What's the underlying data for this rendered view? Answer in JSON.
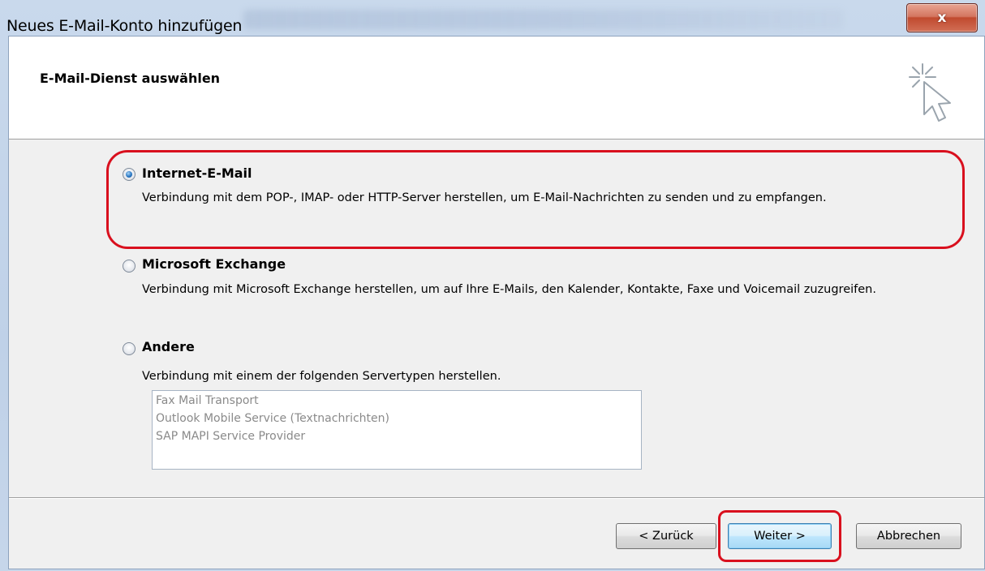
{
  "window": {
    "title": "Neues E-Mail-Konto hinzufügen",
    "close_symbol": "x"
  },
  "header": {
    "title": "E-Mail-Dienst auswählen",
    "icon": "wizard-cursor-icon"
  },
  "options": [
    {
      "label": "Internet-E-Mail",
      "description": "Verbindung mit dem POP-, IMAP- oder HTTP-Server herstellen, um E-Mail-Nachrichten zu senden und zu empfangen.",
      "selected": true,
      "highlighted": true
    },
    {
      "label": "Microsoft Exchange",
      "description": "Verbindung mit Microsoft Exchange herstellen, um auf Ihre E-Mails, den Kalender, Kontakte, Faxe und Voicemail zuzugreifen.",
      "selected": false
    },
    {
      "label": "Andere",
      "description": "Verbindung mit einem der folgenden Servertypen herstellen.",
      "selected": false
    }
  ],
  "server_types": [
    "Fax Mail Transport",
    "Outlook Mobile Service (Textnachrichten)",
    "SAP MAPI Service Provider"
  ],
  "buttons": {
    "back": "< Zurück",
    "next": "Weiter >",
    "cancel": "Abbrechen"
  },
  "colors": {
    "highlight_ring": "#d9101e",
    "primary_button_border": "#3c7fb1"
  }
}
